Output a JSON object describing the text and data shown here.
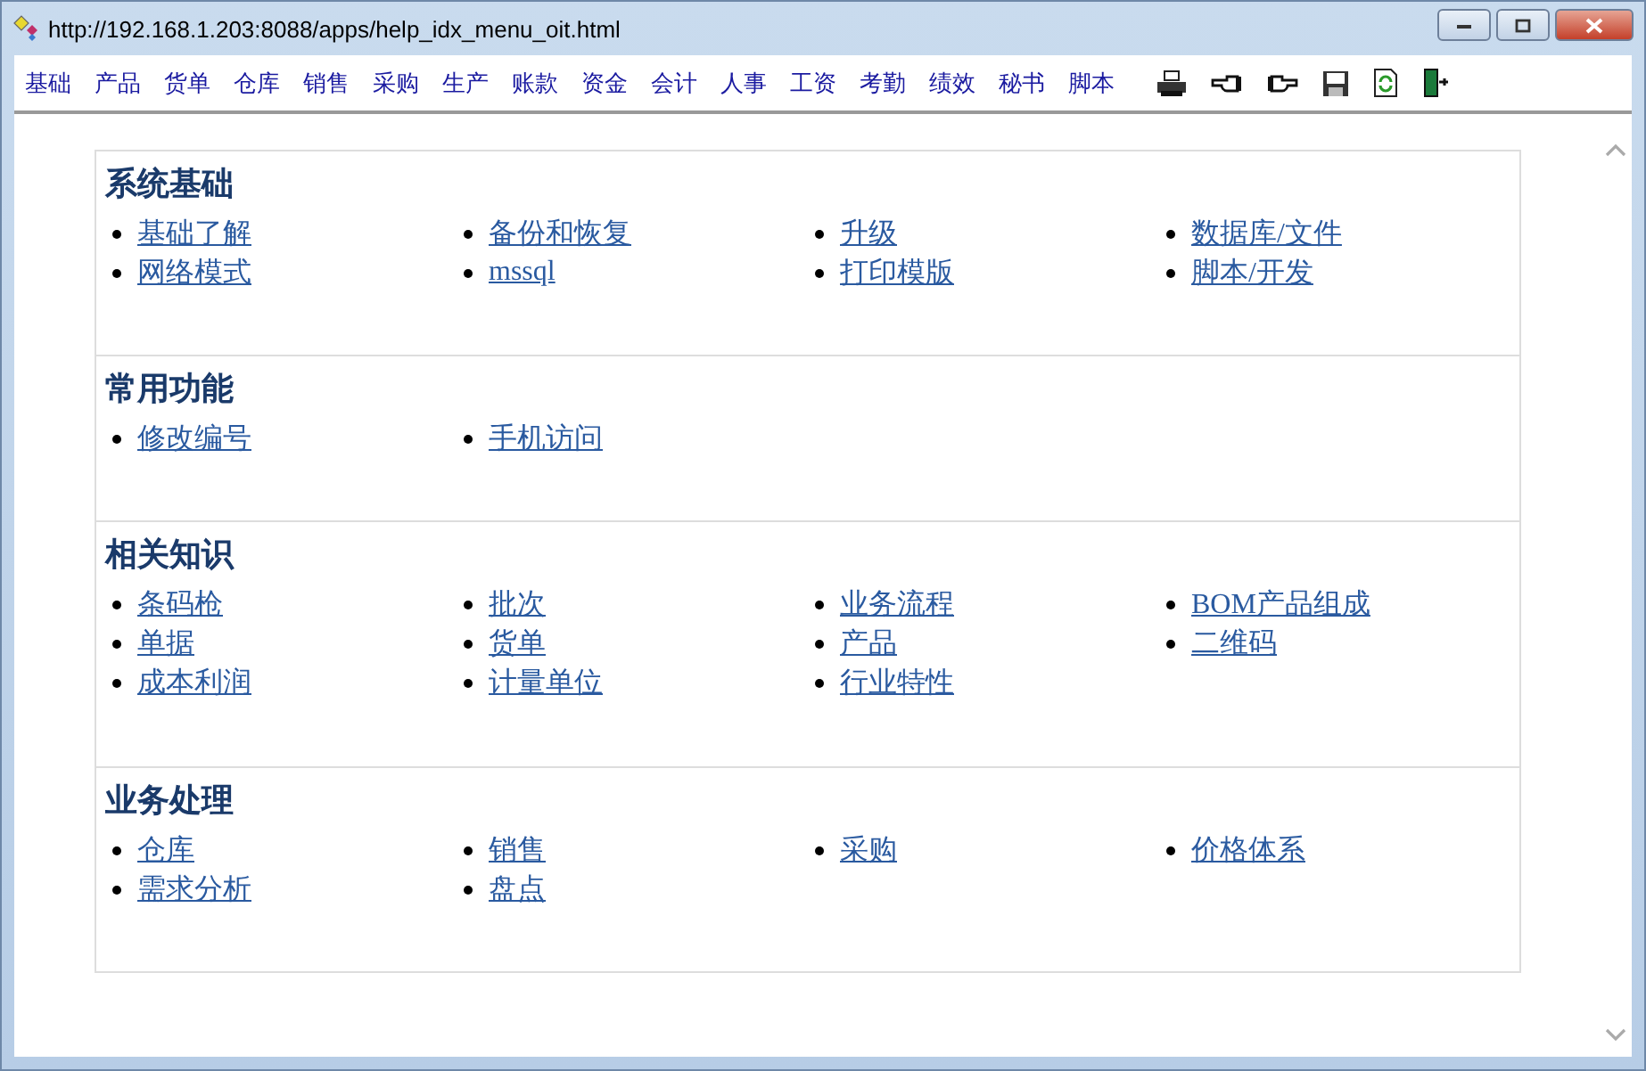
{
  "window": {
    "title": "http://192.168.1.203:8088/apps/help_idx_menu_oit.html"
  },
  "menu": [
    "基础",
    "产品",
    "货单",
    "仓库",
    "销售",
    "采购",
    "生产",
    "账款",
    "资金",
    "会计",
    "人事",
    "工资",
    "考勤",
    "绩效",
    "秘书",
    "脚本"
  ],
  "toolbar": [
    {
      "kind": "print"
    },
    {
      "kind": "back"
    },
    {
      "kind": "forward"
    },
    {
      "kind": "save"
    },
    {
      "kind": "refresh"
    },
    {
      "kind": "exit"
    }
  ],
  "sections": [
    {
      "title": "系统基础",
      "links": [
        "基础了解",
        "备份和恢复",
        "升级",
        "数据库/文件",
        "网络模式",
        "mssql",
        "打印模版",
        "脚本/开发"
      ]
    },
    {
      "title": "常用功能",
      "links": [
        "修改编号",
        "手机访问"
      ]
    },
    {
      "title": "相关知识",
      "links": [
        "条码枪",
        "批次",
        "业务流程",
        "BOM产品组成",
        "单据",
        "货单",
        "产品",
        "二维码",
        "成本利润",
        "计量单位",
        "行业特性"
      ]
    },
    {
      "title": "业务处理",
      "links": [
        "仓库",
        "销售",
        "采购",
        "价格体系",
        "需求分析",
        "盘点"
      ]
    }
  ]
}
